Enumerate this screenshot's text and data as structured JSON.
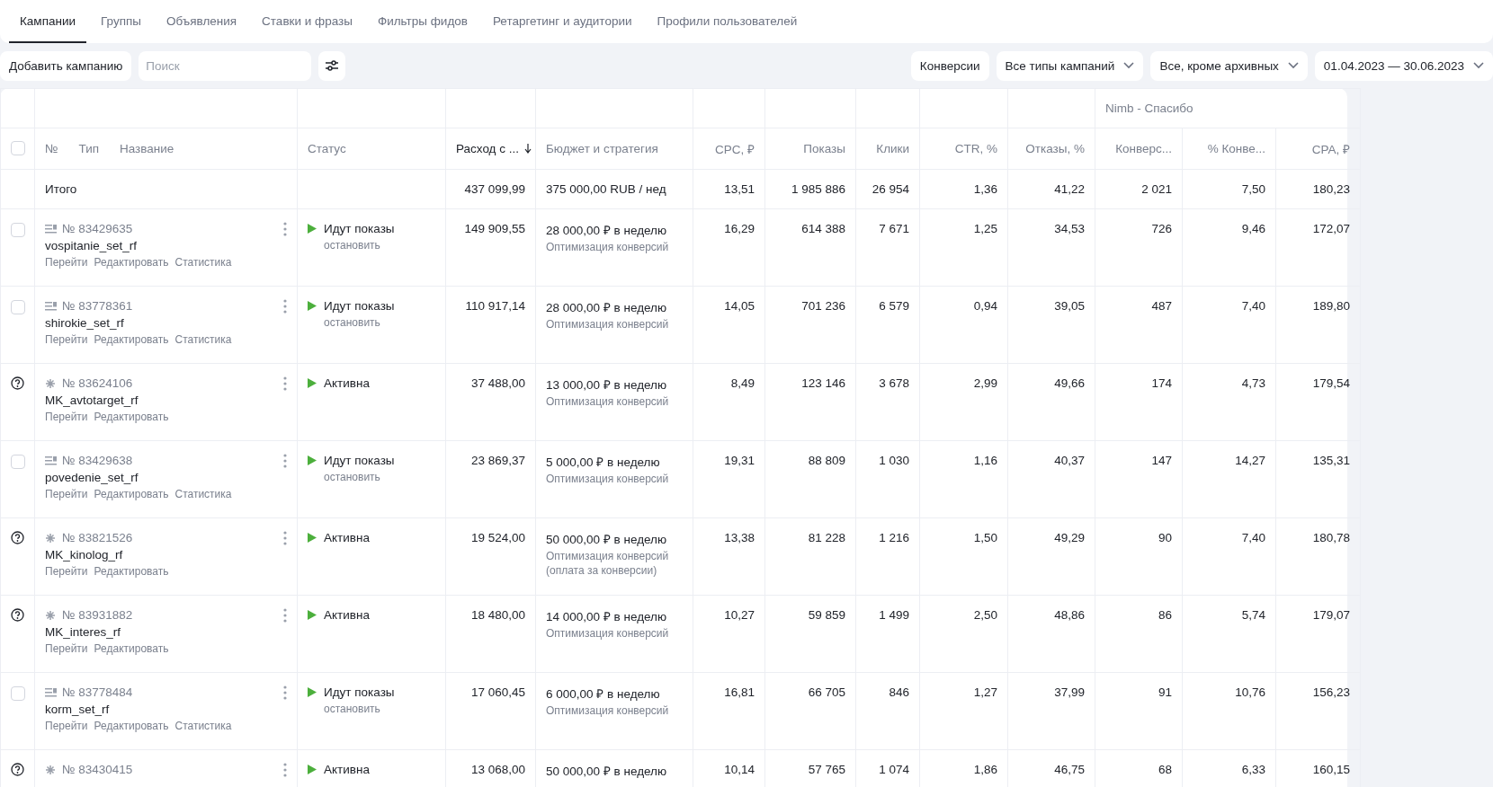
{
  "tabs": [
    {
      "label": "Кампании",
      "selected": true
    },
    {
      "label": "Группы",
      "selected": false
    },
    {
      "label": "Объявления",
      "selected": false
    },
    {
      "label": "Ставки и фразы",
      "selected": false
    },
    {
      "label": "Фильтры фидов",
      "selected": false
    },
    {
      "label": "Ретаргетинг и аудитории",
      "selected": false
    },
    {
      "label": "Профили пользователей",
      "selected": false
    }
  ],
  "toolbar": {
    "add_button": "Добавить кампанию",
    "search": {
      "placeholder": "Поиск"
    },
    "conversions_button": "Конверсии",
    "dropdowns": [
      "Все типы кампаний",
      "Все, кроме архивных",
      "01.04.2023 — 30.06.2023"
    ]
  },
  "table": {
    "group_header": "Nimb - Спасибо",
    "columns": [
      {
        "label": "Статус",
        "sorted": false
      },
      {
        "label": "Расход с ...",
        "sorted": true
      },
      {
        "label": "Бюджет и стратегия",
        "sorted": false
      }
    ],
    "metric_columns": [
      {
        "label": "CPC, ₽",
        "sorted": false
      },
      {
        "label": "Показы",
        "sorted": false
      },
      {
        "label": "Клики",
        "sorted": false
      },
      {
        "label": "CTR, %",
        "sorted": false
      },
      {
        "label": "Отказы, %",
        "sorted": false
      },
      {
        "label": "Конверс...",
        "sorted": false
      },
      {
        "label": "% Конве...",
        "sorted": false
      },
      {
        "label": "CPA, ₽",
        "sorted": false
      }
    ],
    "name_headers": [
      "№",
      "Тип",
      "Название"
    ],
    "select_all": {
      "checked": false
    },
    "total": {
      "label": "Итого",
      "spend": "437 099,99",
      "budget": "375 000,00 RUB / нед",
      "cells": [
        "13,51",
        "1 985 886",
        "26 954",
        "1,36",
        "41,22",
        "2 021",
        "7,50",
        "180,23"
      ]
    },
    "rows": [
      {
        "kind": "text",
        "checked": false,
        "number": "№ 83429635",
        "name": "vospitanie_set_rf",
        "links": [
          "Перейти",
          "Редактировать",
          "Статистика"
        ],
        "status": "Идут показы",
        "status_action": "остановить",
        "spend": "149 909,55",
        "budget": "28 000,00 ₽ в неделю",
        "strategy": [
          "Оптимизация конверсий"
        ],
        "cells": [
          "16,29",
          "614 388",
          "7 671",
          "1,25",
          "34,53",
          "726",
          "9,46",
          "172,07"
        ]
      },
      {
        "kind": "text",
        "checked": false,
        "number": "№ 83778361",
        "name": "shirokie_set_rf",
        "links": [
          "Перейти",
          "Редактировать",
          "Статистика"
        ],
        "status": "Идут показы",
        "status_action": "остановить",
        "spend": "110 917,14",
        "budget": "28 000,00 ₽ в неделю",
        "strategy": [
          "Оптимизация конверсий"
        ],
        "cells": [
          "14,05",
          "701 236",
          "6 579",
          "0,94",
          "39,05",
          "487",
          "7,40",
          "189,80"
        ]
      },
      {
        "kind": "master",
        "number": "№ 83624106",
        "name": "MK_avtotarget_rf",
        "links": [
          "Перейти",
          "Редактировать"
        ],
        "status": "Активна",
        "spend": "37 488,00",
        "budget": "13 000,00 ₽ в неделю",
        "strategy": [
          "Оптимизация конверсий"
        ],
        "cells": [
          "8,49",
          "123 146",
          "3 678",
          "2,99",
          "49,66",
          "174",
          "4,73",
          "179,54"
        ]
      },
      {
        "kind": "text",
        "checked": false,
        "number": "№ 83429638",
        "name": "povedenie_set_rf",
        "links": [
          "Перейти",
          "Редактировать",
          "Статистика"
        ],
        "status": "Идут показы",
        "status_action": "остановить",
        "spend": "23 869,37",
        "budget": "5 000,00 ₽ в неделю",
        "strategy": [
          "Оптимизация конверсий"
        ],
        "cells": [
          "19,31",
          "88 809",
          "1 030",
          "1,16",
          "40,37",
          "147",
          "14,27",
          "135,31"
        ]
      },
      {
        "kind": "master",
        "number": "№ 83821526",
        "name": "MK_kinolog_rf",
        "links": [
          "Перейти",
          "Редактировать"
        ],
        "status": "Активна",
        "spend": "19 524,00",
        "budget": "50 000,00 ₽ в неделю",
        "strategy": [
          "Оптимизация конверсий",
          "(оплата за конверсии)"
        ],
        "cells": [
          "13,38",
          "81 228",
          "1 216",
          "1,50",
          "49,29",
          "90",
          "7,40",
          "180,78"
        ]
      },
      {
        "kind": "master",
        "number": "№ 83931882",
        "name": "MK_interes_rf",
        "links": [
          "Перейти",
          "Редактировать"
        ],
        "status": "Активна",
        "spend": "18 480,00",
        "budget": "14 000,00 ₽ в неделю",
        "strategy": [
          "Оптимизация конверсий"
        ],
        "cells": [
          "10,27",
          "59 859",
          "1 499",
          "2,50",
          "48,86",
          "86",
          "5,74",
          "179,07"
        ]
      },
      {
        "kind": "text",
        "checked": false,
        "number": "№ 83778484",
        "name": "korm_set_rf",
        "links": [
          "Перейти",
          "Редактировать",
          "Статистика"
        ],
        "status": "Идут показы",
        "status_action": "остановить",
        "spend": "17 060,45",
        "budget": "6 000,00 ₽ в неделю",
        "strategy": [
          "Оптимизация конверсий"
        ],
        "cells": [
          "16,81",
          "66 705",
          "846",
          "1,27",
          "37,99",
          "91",
          "10,76",
          "156,23"
        ]
      },
      {
        "kind": "master",
        "number": "№ 83430415",
        "status": "Активна",
        "spend": "13 068,00",
        "budget": "50 000,00 ₽ в неделю",
        "cells": [
          "10,14",
          "57 765",
          "1 074",
          "1,86",
          "46,75",
          "68",
          "6,33",
          "160,15"
        ]
      }
    ]
  }
}
